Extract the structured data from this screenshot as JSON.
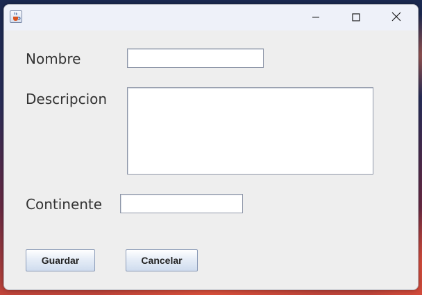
{
  "window": {
    "title": "",
    "app_icon": "java-cup-icon",
    "controls": {
      "minimize_icon": "minimize-icon",
      "maximize_icon": "maximize-icon",
      "close_icon": "close-icon"
    }
  },
  "form": {
    "nombre": {
      "label": "Nombre",
      "value": ""
    },
    "descripcion": {
      "label": "Descripcion",
      "value": ""
    },
    "continente": {
      "label": "Continente",
      "value": ""
    }
  },
  "buttons": {
    "guardar": "Guardar",
    "cancelar": "Cancelar"
  },
  "colors": {
    "window_bg": "#eeeeee",
    "titlebar_bg": "#eef1f9",
    "field_border": "#8e96a8",
    "label_text": "#333333"
  }
}
